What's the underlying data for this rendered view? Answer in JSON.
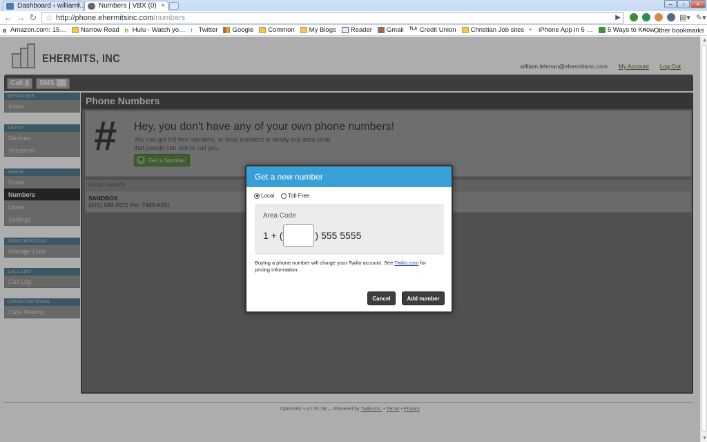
{
  "browser": {
    "tabs": [
      {
        "title": "Dashboard ‹ williaml…",
        "close": "×"
      },
      {
        "title": "Numbers | VBX (0)",
        "close": "×"
      }
    ],
    "url_host": "http://phone.ehermitsinc.com",
    "url_path": "/numbers",
    "bookmarks": [
      {
        "label": "Amazon.com: 15…",
        "icon": "amazon-icon"
      },
      {
        "label": "Narrow Road",
        "icon": "folder-icon"
      },
      {
        "label": "Hulu - Watch yo…",
        "icon": "hulu-icon"
      },
      {
        "label": "Twitter",
        "icon": "twitter-icon"
      },
      {
        "label": "Google",
        "icon": "google-icon"
      },
      {
        "label": "Common",
        "icon": "folder-icon"
      },
      {
        "label": "My Blogs",
        "icon": "folder-icon"
      },
      {
        "label": "Reader",
        "icon": "reader-icon"
      },
      {
        "label": "Gmail",
        "icon": "gmail-icon"
      },
      {
        "label": "Credit Union",
        "icon": "tla-icon"
      },
      {
        "label": "Christian Job sites",
        "icon": "folder-icon"
      },
      {
        "label": "iPhone App in 5 …",
        "icon": "app-icon"
      },
      {
        "label": "5 Ways to Know …",
        "icon": "link-icon"
      }
    ],
    "bookmarks_other": "Other bookmarks",
    "chevron": "»"
  },
  "header": {
    "brand": "EHERMITS, INC",
    "email": "william.lehman@ehermitsinc.com",
    "my_account": "My Account",
    "log_out": "Log Out"
  },
  "topbar": {
    "call": "Call",
    "sms": "SMS"
  },
  "sidebar": {
    "groups": [
      {
        "head": "MESSAGES",
        "items": [
          "Inbox"
        ]
      },
      {
        "head": "SETUP",
        "items": [
          "Devices",
          "Voicemail"
        ]
      },
      {
        "head": "ADMIN",
        "items": [
          "Flows",
          "Numbers",
          "Users",
          "Settings"
        ]
      },
      {
        "head": "SUBSCRIPTIONS",
        "items": [
          "Manage Lists"
        ]
      },
      {
        "head": "CALL LOG",
        "items": [
          "Call Log"
        ]
      },
      {
        "head": "OPERATOR PANEL",
        "items": [
          "Calls Waiting"
        ]
      }
    ],
    "active": "Numbers"
  },
  "main": {
    "title": "Phone Numbers",
    "hero_title": "Hey, you don't have any of your own phone numbers!",
    "hero_text": "You can get toll free numbers, or local numbers in nearly any area code, that people can use to call you.",
    "get_number": "Get a Number",
    "table_head": "PHONE NUMBER",
    "row_name": "SANDBOX",
    "row_detail": "(415) 599-2671 Pin: 7483-9291"
  },
  "footer": {
    "version": "OpenVBX • v0.79 r38 — Powered by",
    "twilio": "Twilio Inc.",
    "sep": "•",
    "terms": "Terms",
    "privacy": "Privacy"
  },
  "modal": {
    "title": "Get a new number",
    "local": "Local",
    "toll_free": "Toll-Free",
    "area_code_label": "Area Code",
    "prefix": "1 + (",
    "suffix": ") 555 5555",
    "area_code_value": "",
    "note_before": "Buying a phone number will charge your Twilio account. See",
    "note_link": "Twilio.com",
    "note_after": "for pricing information.",
    "cancel": "Cancel",
    "add": "Add number"
  },
  "colors": {
    "modal_header": "#38a0d9",
    "sidebar_head": "#5b7f96",
    "green_button": "#5f8a4a"
  }
}
